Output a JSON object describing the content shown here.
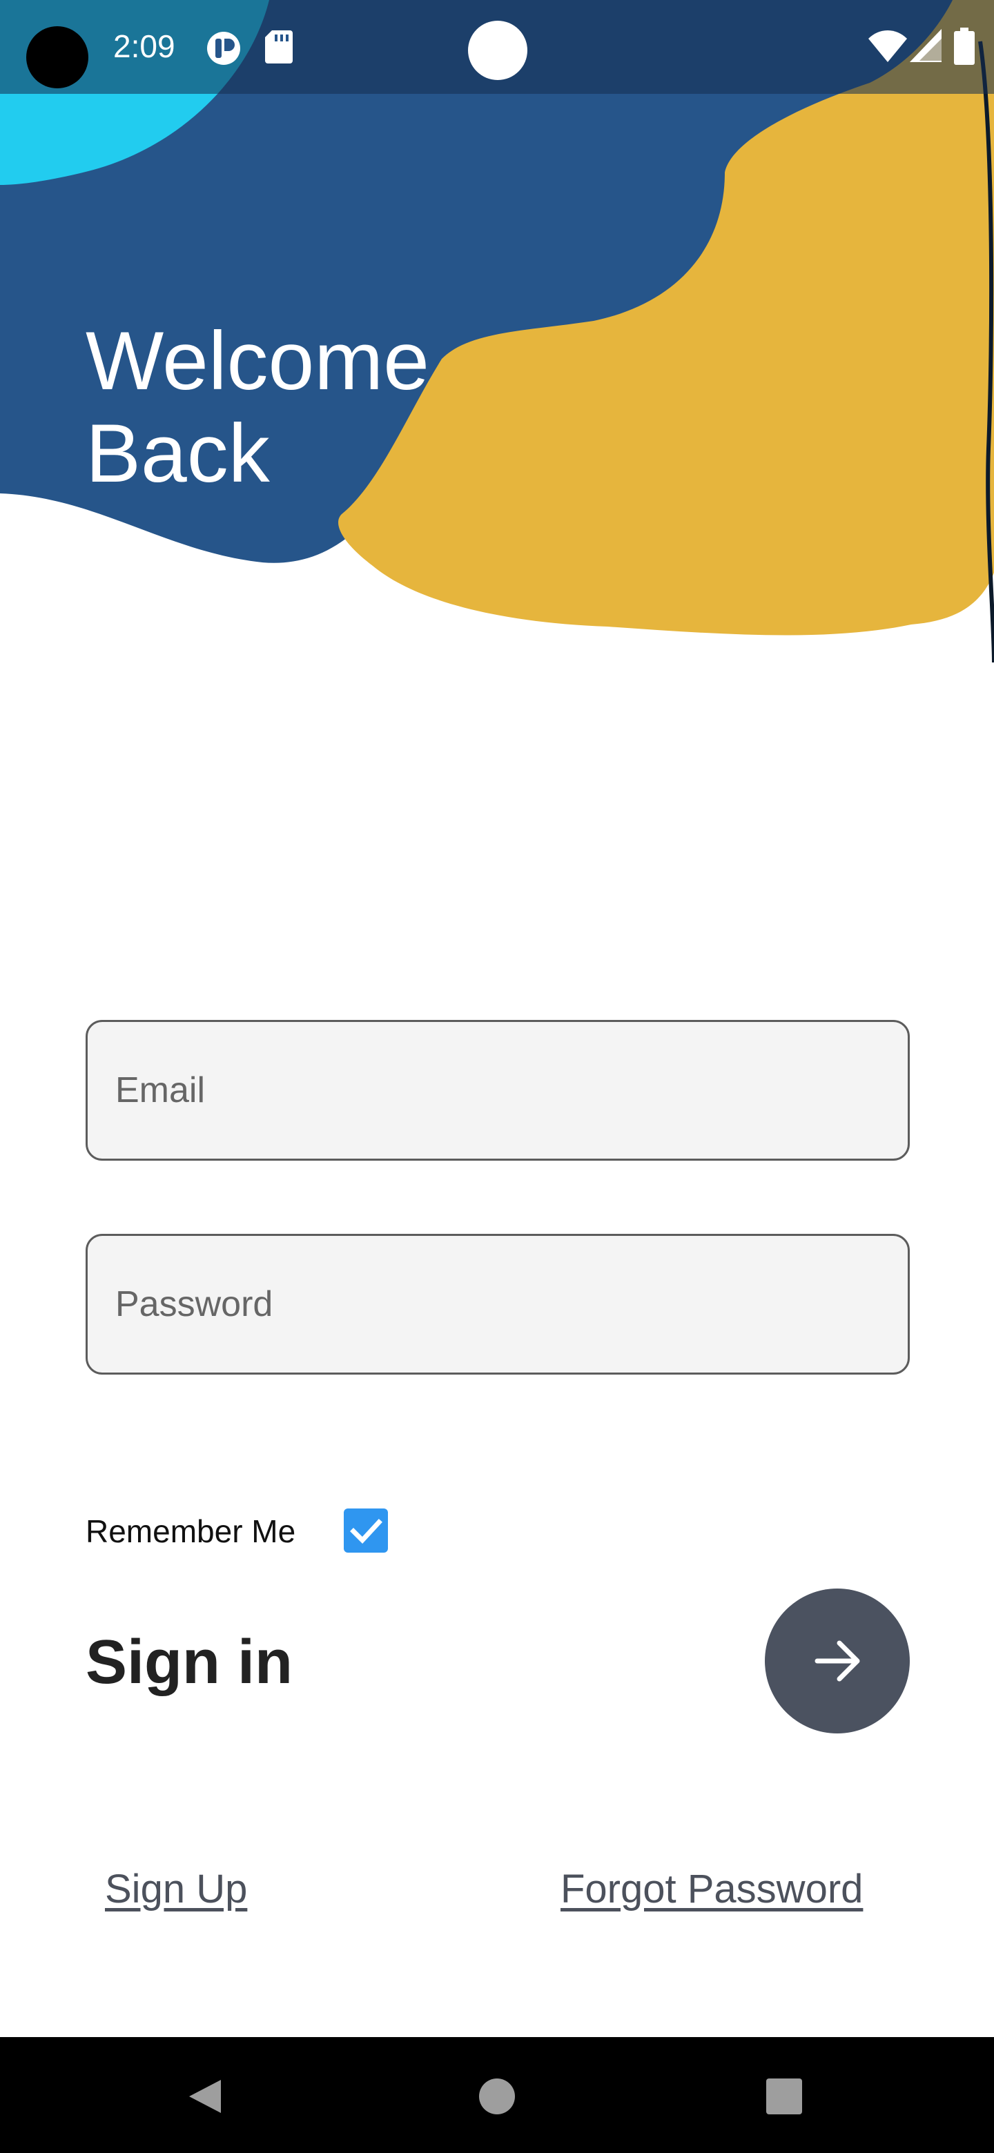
{
  "status_bar": {
    "time": "2:09",
    "icons": [
      "app-notification-icon",
      "sd-card-icon",
      "wifi-icon",
      "signal-icon",
      "battery-icon"
    ]
  },
  "header": {
    "title_line1": "Welcome",
    "title_line2": "Back"
  },
  "form": {
    "email_placeholder": "Email",
    "password_placeholder": "Password",
    "remember_label": "Remember Me",
    "remember_checked": true
  },
  "actions": {
    "sign_in_label": "Sign in",
    "sign_up_link": "Sign Up",
    "forgot_password_link": "Forgot Password"
  },
  "theme": {
    "blue": "#26558a",
    "yellow": "#e6b53d",
    "cyan": "#22ccef",
    "fab": "#4b5260",
    "checkbox": "#2f96f0"
  },
  "nav": {
    "icons": [
      "back-icon",
      "home-icon",
      "recents-icon"
    ]
  }
}
